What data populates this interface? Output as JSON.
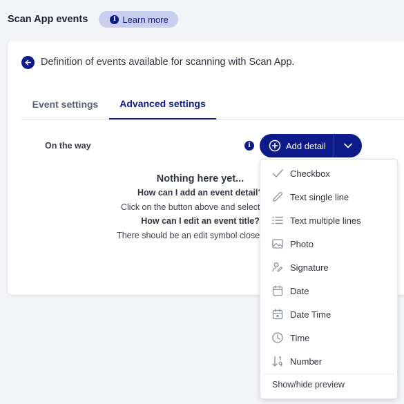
{
  "header": {
    "title": "Scan App events",
    "learn_more": "Learn more",
    "info_glyph": "i"
  },
  "card": {
    "description": "Definition of events available for scanning with Scan App.",
    "tabs": [
      {
        "label": "Event settings",
        "active": false
      },
      {
        "label": "Advanced settings",
        "active": true
      }
    ],
    "section_label": "On the way",
    "info_glyph": "i",
    "add_detail_label": "Add detail",
    "empty": {
      "title": "Nothing here yet...",
      "q1": "How can I add an event detail?",
      "a1": "Click on the button above and select from",
      "q2": "How can I edit an event title?",
      "a2": "There should be an edit symbol close to the"
    }
  },
  "dropdown": {
    "items": [
      {
        "label": "Checkbox",
        "icon": "checkmark-icon"
      },
      {
        "label": "Text single line",
        "icon": "pencil-icon"
      },
      {
        "label": "Text multiple lines",
        "icon": "list-icon"
      },
      {
        "label": "Photo",
        "icon": "image-icon"
      },
      {
        "label": "Signature",
        "icon": "signature-icon"
      },
      {
        "label": "Date",
        "icon": "calendar-icon"
      },
      {
        "label": "Date Time",
        "icon": "calendar-clock-icon"
      },
      {
        "label": "Time",
        "icon": "clock-icon"
      },
      {
        "label": "Number",
        "icon": "sort-number-icon"
      }
    ],
    "footer": "Show/hide preview"
  },
  "colors": {
    "accent": "#0d1a8a",
    "badge_bg": "#c9cdee",
    "page_bg": "#f3f4f8",
    "icon_gray": "#8a8f9c"
  }
}
